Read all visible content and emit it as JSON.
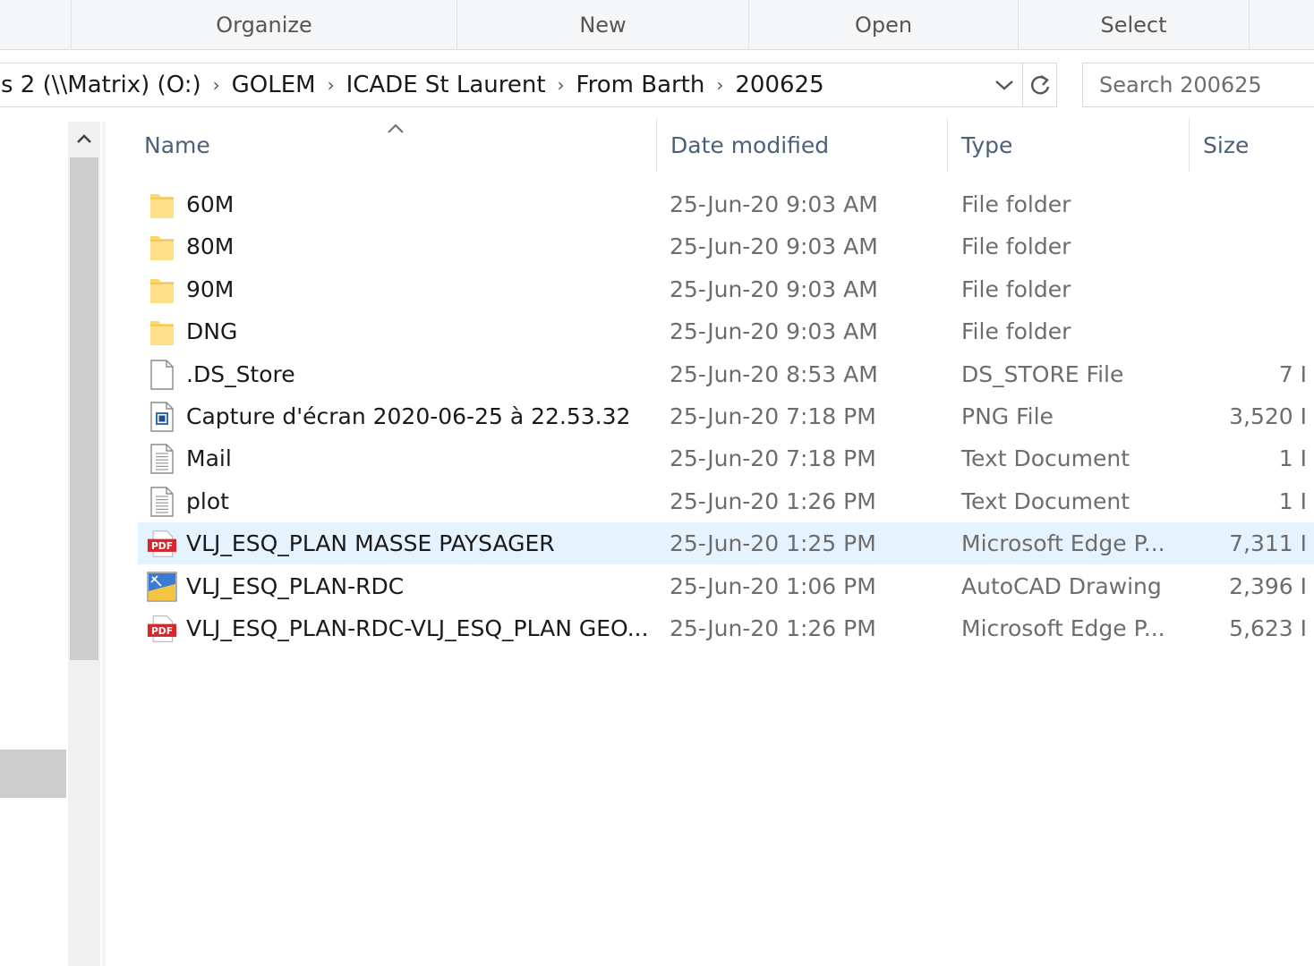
{
  "ribbon": {
    "groups": [
      {
        "label": "Organize"
      },
      {
        "label": "New"
      },
      {
        "label": "Open"
      },
      {
        "label": "Select"
      }
    ]
  },
  "address": {
    "crumbs": [
      "s 2 (\\\\Matrix) (O:)",
      "GOLEM",
      "ICADE St Laurent",
      "From Barth",
      "200625"
    ],
    "dropdown_icon": "chevron-down-icon",
    "refresh_icon": "refresh-icon"
  },
  "search": {
    "placeholder": "Search 200625"
  },
  "columns": {
    "name": "Name",
    "date": "Date modified",
    "type": "Type",
    "size": "Size"
  },
  "files": [
    {
      "icon": "folder-icon",
      "name": "60M",
      "date": "25-Jun-20 9:03 AM",
      "type": "File folder",
      "size": ""
    },
    {
      "icon": "folder-icon",
      "name": "80M",
      "date": "25-Jun-20 9:03 AM",
      "type": "File folder",
      "size": ""
    },
    {
      "icon": "folder-icon",
      "name": "90M",
      "date": "25-Jun-20 9:03 AM",
      "type": "File folder",
      "size": ""
    },
    {
      "icon": "folder-icon",
      "name": "DNG",
      "date": "25-Jun-20 9:03 AM",
      "type": "File folder",
      "size": ""
    },
    {
      "icon": "blank-file-icon",
      "name": ".DS_Store",
      "date": "25-Jun-20 8:53 AM",
      "type": "DS_STORE File",
      "size": "7 I"
    },
    {
      "icon": "image-file-icon",
      "name": "Capture d'écran 2020-06-25 à 22.53.32",
      "date": "25-Jun-20 7:18 PM",
      "type": "PNG File",
      "size": "3,520 I"
    },
    {
      "icon": "text-file-icon",
      "name": "Mail",
      "date": "25-Jun-20 7:18 PM",
      "type": "Text Document",
      "size": "1 I"
    },
    {
      "icon": "text-file-icon",
      "name": "plot",
      "date": "25-Jun-20 1:26 PM",
      "type": "Text Document",
      "size": "1 I"
    },
    {
      "icon": "pdf-file-icon",
      "name": "VLJ_ESQ_PLAN MASSE PAYSAGER",
      "date": "25-Jun-20 1:25 PM",
      "type": "Microsoft Edge P...",
      "size": "7,311 I",
      "selected": true
    },
    {
      "icon": "autocad-file-icon",
      "name": "VLJ_ESQ_PLAN-RDC",
      "date": "25-Jun-20 1:06 PM",
      "type": "AutoCAD Drawing",
      "size": "2,396 I"
    },
    {
      "icon": "pdf-file-icon",
      "name": "VLJ_ESQ_PLAN-RDC-VLJ_ESQ_PLAN GEO...",
      "date": "25-Jun-20 1:26 PM",
      "type": "Microsoft Edge P...",
      "size": "5,623 I"
    }
  ],
  "icon_labels": {
    "pdf": "PDF"
  },
  "colors": {
    "selected_row": "#e5f3ff",
    "header_text": "#4c607a",
    "folder_yellow": "#ffd766",
    "pdf_red": "#d8262e"
  }
}
